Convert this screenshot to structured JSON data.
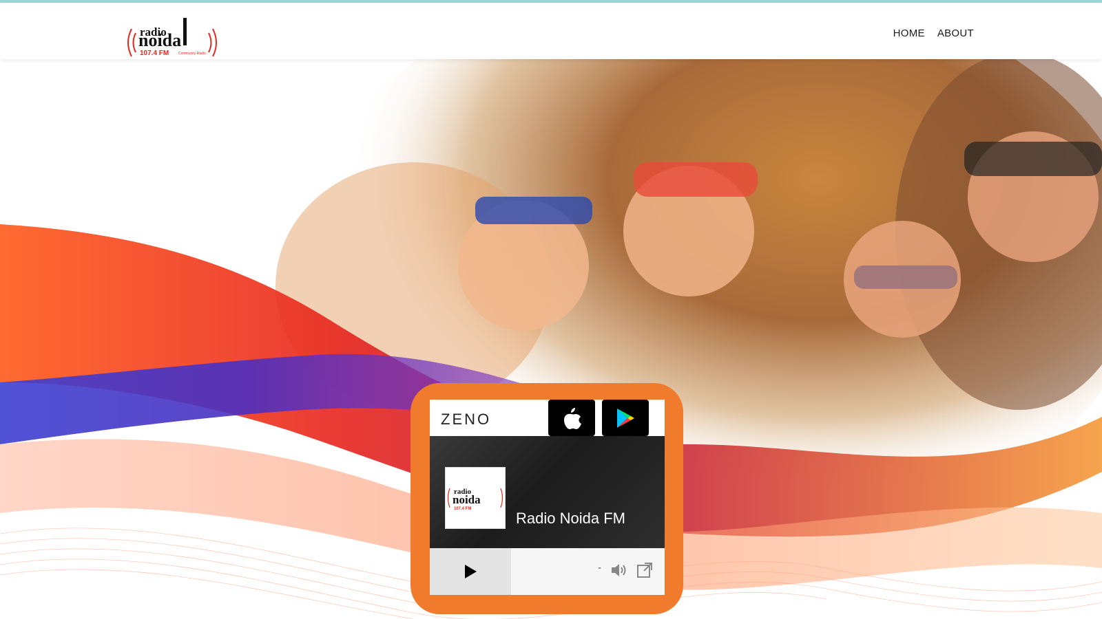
{
  "site": {
    "logo": {
      "word_top": "radio",
      "word_main": "noida",
      "freq": "107.4 FM",
      "tag": "Community Radio"
    },
    "nav": [
      {
        "label": "HOME"
      },
      {
        "label": "ABOUT"
      }
    ]
  },
  "player": {
    "brand": "ZENO",
    "station_name": "Radio Noida FM",
    "time_text": "-",
    "apple_label": "App Store",
    "google_label": "Google Play"
  },
  "colors": {
    "accent_orange": "#f07b2c",
    "top_line": "#9fd3d6",
    "wave_red": "#e8261d",
    "wave_blue": "#3d3fd1"
  },
  "icons": [
    "apple-icon",
    "google-play-icon",
    "play-icon",
    "volume-icon",
    "external-link-icon"
  ]
}
